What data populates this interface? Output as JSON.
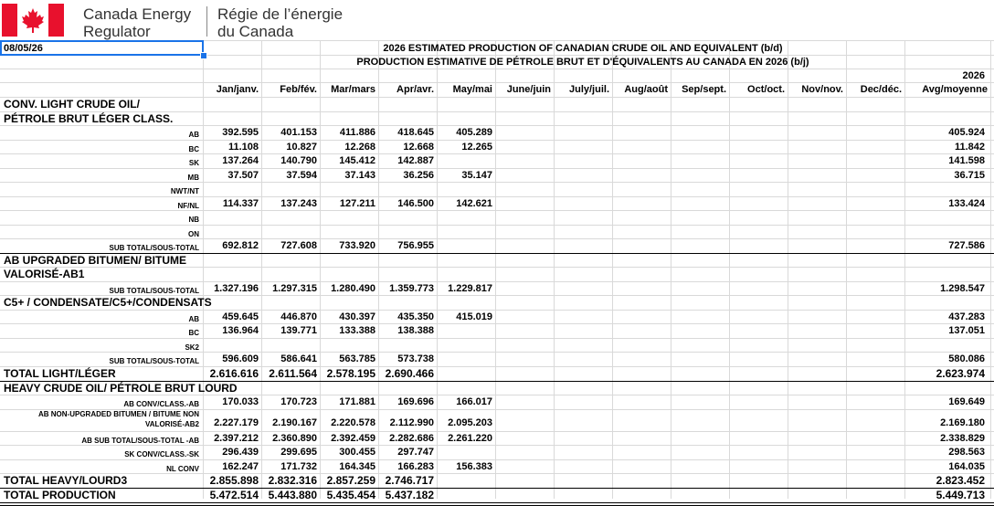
{
  "logo": {
    "en_line1": "Canada Energy",
    "en_line2": "Regulator",
    "fr_line1": "Régie de l’énergie",
    "fr_line2": "du Canada",
    "flag_red": "#e8112d",
    "icon": "canada-flag-icon"
  },
  "date": "08/05/26",
  "title_en": "2026 ESTIMATED PRODUCTION OF CANADIAN CRUDE OIL AND EQUIVALENT  (b/d)",
  "title_fr": "PRODUCTION ESTIMATIVE DE PÉTROLE BRUT ET D'ÉQUIVALENTS AU CANADA EN 2026 (b/j)",
  "year": "2026",
  "headers": [
    "Jan/janv.",
    "Feb/fév.",
    "Mar/mars",
    "Apr/avr.",
    "May/mai",
    "June/juin",
    "July/juil.",
    "Aug/août",
    "Sep/sept.",
    "Oct/oct.",
    "Nov/nov.",
    "Dec/déc.",
    "Avg/moyenne"
  ],
  "rows": [
    {
      "label": "CONV. LIGHT CRUDE OIL/",
      "kind": "section",
      "values": []
    },
    {
      "label": "PÉTROLE BRUT LÉGER CLASS.",
      "kind": "section",
      "values": []
    },
    {
      "label": "AB",
      "kind": "sub",
      "values": [
        "392.595",
        "401.153",
        "411.886",
        "418.645",
        "405.289"
      ],
      "avg": "405.924"
    },
    {
      "label": "BC",
      "kind": "sub",
      "values": [
        "11.108",
        "10.827",
        "12.268",
        "12.668",
        "12.265"
      ],
      "avg": "11.842"
    },
    {
      "label": "SK",
      "kind": "sub",
      "values": [
        "137.264",
        "140.790",
        "145.412",
        "142.887"
      ],
      "avg": "141.598"
    },
    {
      "label": "MB",
      "kind": "sub",
      "values": [
        "37.507",
        "37.594",
        "37.143",
        "36.256",
        "35.147"
      ],
      "avg": "36.715"
    },
    {
      "label": "NWT/NT",
      "kind": "sub",
      "values": []
    },
    {
      "label": "NF/NL",
      "kind": "sub",
      "values": [
        "114.337",
        "137.243",
        "127.211",
        "146.500",
        "142.621"
      ],
      "avg": "133.424"
    },
    {
      "label": "NB",
      "kind": "sub",
      "values": []
    },
    {
      "label": "ON",
      "kind": "sub",
      "values": []
    },
    {
      "label": "SUB TOTAL/SOUS-TOTAL",
      "kind": "sub",
      "values": [
        "692.812",
        "727.608",
        "733.920",
        "756.955"
      ],
      "avg": "727.586"
    },
    {
      "label": "AB UPGRADED BITUMEN/ BITUME",
      "kind": "section",
      "values": []
    },
    {
      "label": "VALORISÉ-AB1",
      "kind": "section",
      "values": []
    },
    {
      "label": "SUB TOTAL/SOUS-TOTAL",
      "kind": "sub",
      "values": [
        "1.327.196",
        "1.297.315",
        "1.280.490",
        "1.359.773",
        "1.229.817"
      ],
      "avg": "1.298.547"
    },
    {
      "label": "C5+ / CONDENSATE/C5+/CONDENSATS",
      "kind": "section",
      "values": []
    },
    {
      "label": "AB",
      "kind": "sub",
      "values": [
        "459.645",
        "446.870",
        "430.397",
        "435.350",
        "415.019"
      ],
      "avg": "437.283"
    },
    {
      "label": "BC",
      "kind": "sub",
      "values": [
        "136.964",
        "139.771",
        "133.388",
        "138.388"
      ],
      "avg": "137.051"
    },
    {
      "label": "SK2",
      "kind": "sub",
      "values": []
    },
    {
      "label": "SUB TOTAL/SOUS-TOTAL",
      "kind": "sub",
      "values": [
        "596.609",
        "586.641",
        "563.785",
        "573.738"
      ],
      "avg": "580.086"
    },
    {
      "label": "TOTAL LIGHT/LÉGER",
      "kind": "total",
      "values": [
        "2.616.616",
        "2.611.564",
        "2.578.195",
        "2.690.466"
      ],
      "avg": "2.623.974"
    },
    {
      "label": "HEAVY CRUDE OIL/ PÉTROLE BRUT LOURD",
      "kind": "section",
      "values": []
    },
    {
      "label": "AB CONV/CLASS.-AB",
      "kind": "sub",
      "values": [
        "170.033",
        "170.723",
        "171.881",
        "169.696",
        "166.017"
      ],
      "avg": "169.649"
    },
    {
      "label": "AB NON-UPGRADED BITUMEN / BITUME NON",
      "label2": "VALORISÉ-AB2",
      "kind": "sub2",
      "values": [
        "2.227.179",
        "2.190.167",
        "2.220.578",
        "2.112.990",
        "2.095.203"
      ],
      "avg": "2.169.180"
    },
    {
      "label": "AB SUB TOTAL/SOUS-TOTAL -AB",
      "kind": "sub",
      "values": [
        "2.397.212",
        "2.360.890",
        "2.392.459",
        "2.282.686",
        "2.261.220"
      ],
      "avg": "2.338.829"
    },
    {
      "label": "SK CONV/CLASS.-SK",
      "kind": "sub",
      "values": [
        "296.439",
        "299.695",
        "300.455",
        "297.747"
      ],
      "avg": "298.563"
    },
    {
      "label": "NL CONV",
      "kind": "sub",
      "values": [
        "162.247",
        "171.732",
        "164.345",
        "166.283",
        "156.383"
      ],
      "avg": "164.035"
    },
    {
      "label": "TOTAL HEAVY/LOURD3",
      "kind": "total",
      "values": [
        "2.855.898",
        "2.832.316",
        "2.857.259",
        "2.746.717"
      ],
      "avg": "2.823.452"
    },
    {
      "label": "TOTAL PRODUCTION",
      "kind": "total",
      "values": [
        "5.472.514",
        "5.443.880",
        "5.435.454",
        "5.437.182"
      ],
      "avg": "5.449.713"
    }
  ]
}
